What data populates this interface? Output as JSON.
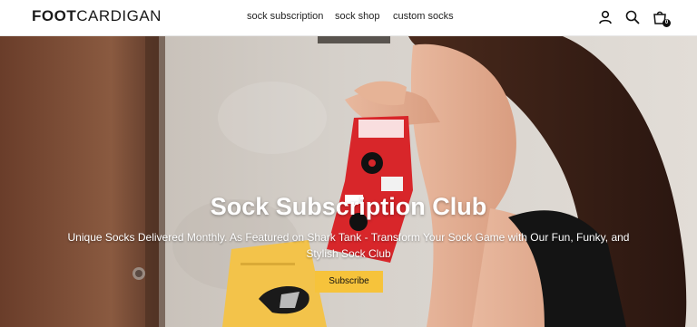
{
  "brand": {
    "logo_bold": "FOOT",
    "logo_light": "CARDIGAN"
  },
  "nav": {
    "items": [
      {
        "label": "sock subscription"
      },
      {
        "label": "sock shop"
      },
      {
        "label": "custom socks"
      }
    ]
  },
  "header_icons": {
    "account": "person-icon",
    "search": "search-icon",
    "cart": "cart-icon",
    "cart_count": "0"
  },
  "hero": {
    "title": "Sock Subscription Club",
    "subtitle": "Unique Socks Delivered Monthly. As Featured on Shark Tank - Transform Your Sock Game with Our Fun, Funky, and Stylish Sock Club",
    "cta_label": "Subscribe"
  },
  "colors": {
    "accent": "#f6c33b",
    "sock_red": "#d8262a",
    "package_yellow": "#f3c34a",
    "wall": "#cfcac4",
    "rust_door": "#7a4a33"
  }
}
